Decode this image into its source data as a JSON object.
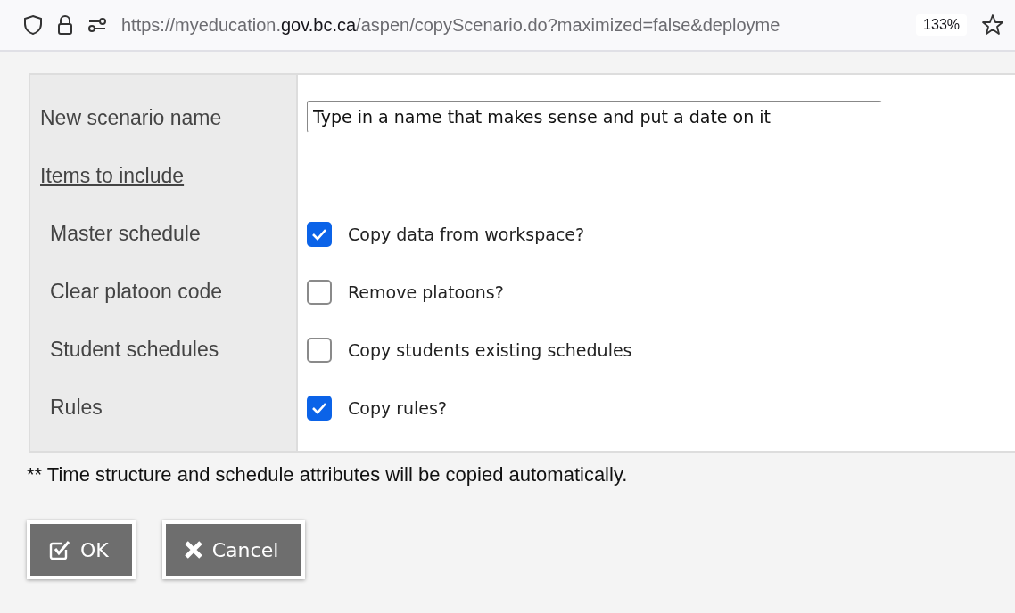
{
  "browser": {
    "url": "https://myeducation.**gov.bc.ca**/aspen/copyScenario.do?maximized=false&deployme",
    "zoom": "133%"
  },
  "form": {
    "name_label": "New scenario name",
    "name_value": "Type in a name that makes sense and put a date on it",
    "section_link": "Items to include",
    "options": [
      {
        "label": "Master schedule",
        "checked": true,
        "text": "Copy data from workspace?"
      },
      {
        "label": "Clear platoon code",
        "checked": false,
        "text": "Remove platoons?"
      },
      {
        "label": "Student schedules",
        "checked": false,
        "text": "Copy students existing schedules"
      },
      {
        "label": "Rules",
        "checked": true,
        "text": "Copy rules?"
      }
    ]
  },
  "note": "** Time structure and schedule attributes will be copied automatically.",
  "buttons": [
    {
      "kind": "ok",
      "label": "OK"
    },
    {
      "kind": "cancel",
      "label": "Cancel"
    }
  ]
}
